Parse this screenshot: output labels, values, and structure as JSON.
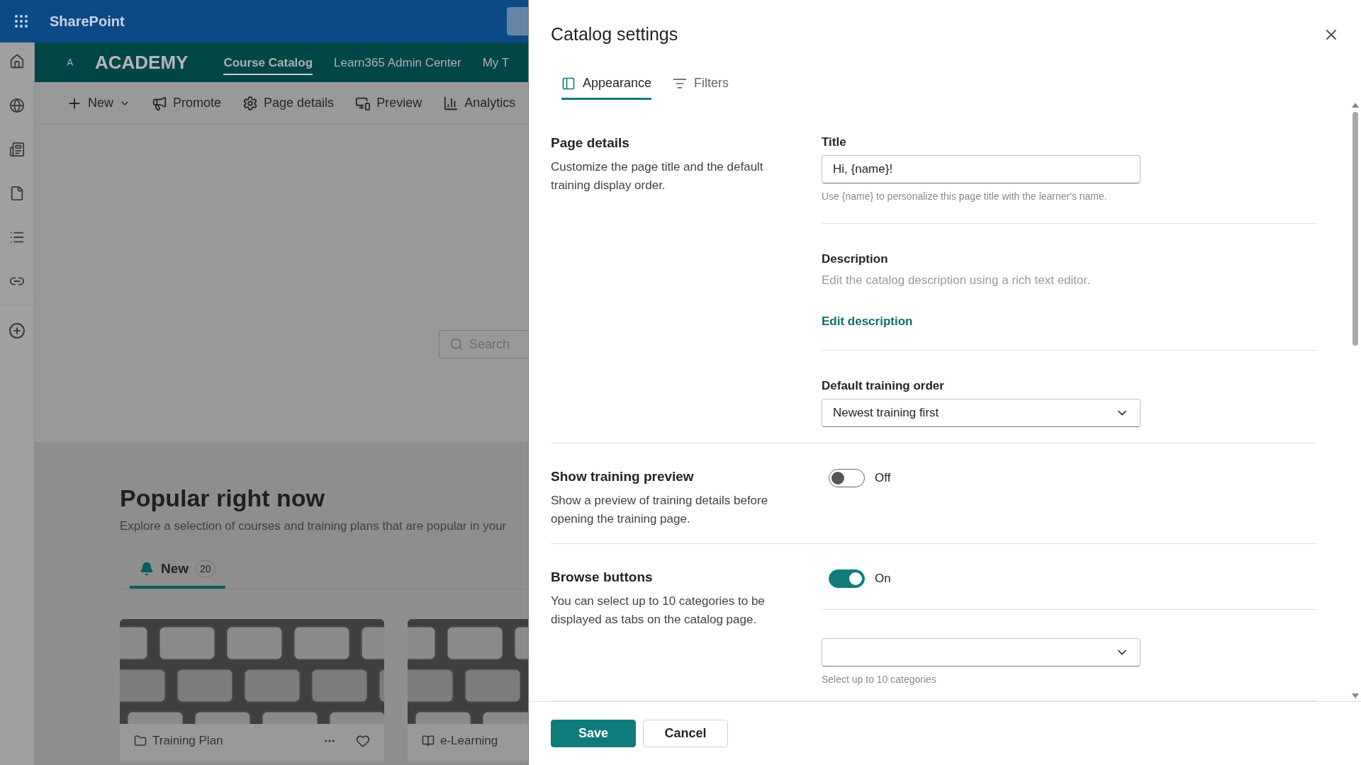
{
  "suite_bar": {
    "app_name": "SharePoint"
  },
  "site_header": {
    "logo_letter": "A",
    "site_name": "ACADEMY",
    "nav": [
      {
        "label": "Course Catalog",
        "selected": true
      },
      {
        "label": "Learn365 Admin Center",
        "selected": false
      },
      {
        "label": "My T",
        "selected": false
      }
    ]
  },
  "command_bar": [
    {
      "label": "New",
      "kind": "new"
    },
    {
      "label": "Promote",
      "kind": "promote"
    },
    {
      "label": "Page details",
      "kind": "details"
    },
    {
      "label": "Preview",
      "kind": "preview"
    },
    {
      "label": "Analytics",
      "kind": "analytics"
    }
  ],
  "search": {
    "placeholder": "Search"
  },
  "section": {
    "title": "Popular right now",
    "subtitle": "Explore a selection of courses and training plans that are popular in your"
  },
  "section_tabs": [
    {
      "label": "New",
      "count": "20",
      "selected": true
    }
  ],
  "cards": [
    {
      "kind": "plan",
      "type_label": "Training Plan"
    },
    {
      "kind": "elearning",
      "type_label": "e-Learning"
    }
  ],
  "panel": {
    "title": "Catalog settings",
    "tabs": [
      {
        "label": "Appearance",
        "selected": true,
        "kind": "appearance"
      },
      {
        "label": "Filters",
        "selected": false,
        "kind": "filters"
      }
    ],
    "sections": [
      {
        "heading": "Page details",
        "description": "Customize the page title and the default training display order.",
        "fields": [
          {
            "kind": "text",
            "label": "Title",
            "value": "Hi, {name}!",
            "help": "Use {name} to personalize this page title with the learner's name."
          },
          {
            "kind": "link",
            "label": "Description",
            "text": "Edit the catalog description using a rich text editor.",
            "link": "Edit description"
          },
          {
            "kind": "select",
            "label": "Default training order",
            "value": "Newest training first"
          }
        ]
      },
      {
        "heading": "Show training preview",
        "description": "Show a preview of training details before opening the training page.",
        "fields": [
          {
            "kind": "toggle",
            "on": false,
            "state_label": "Off"
          }
        ]
      },
      {
        "heading": "Browse buttons",
        "description": "You can select up to 10 categories to be displayed as tabs on the catalog page.",
        "fields": [
          {
            "kind": "toggle",
            "on": true,
            "state_label": "On"
          },
          {
            "kind": "select",
            "help": "Select up to 10 categories"
          }
        ]
      }
    ],
    "buttons": [
      {
        "label": "Save",
        "kind": "primary"
      },
      {
        "label": "Cancel",
        "kind": "secondary"
      }
    ]
  }
}
